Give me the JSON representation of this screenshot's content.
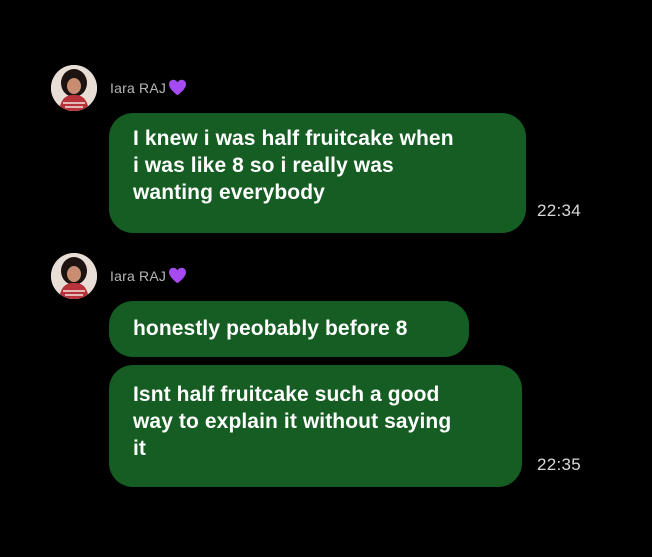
{
  "colors": {
    "background": "#000000",
    "bubble": "#155d22",
    "sender_name": "#b7b7b7",
    "heart": "#a64bf4",
    "timestamp": "#d8d8d8"
  },
  "groups": [
    {
      "sender": {
        "name": "Iara RAJ",
        "badge_icon": "purple-heart-icon"
      },
      "messages": [
        {
          "lines": [
            "I knew i was half fruitcake when",
            "i was like 8 so i really was",
            "wanting everybody"
          ],
          "time": "22:34"
        }
      ]
    },
    {
      "sender": {
        "name": "Iara RAJ",
        "badge_icon": "purple-heart-icon"
      },
      "messages": [
        {
          "lines": [
            "honestly peobably before 8"
          ]
        },
        {
          "lines": [
            "Isnt half fruitcake such a good",
            "way to explain it without saying",
            "it"
          ],
          "time": "22:35"
        }
      ]
    }
  ]
}
